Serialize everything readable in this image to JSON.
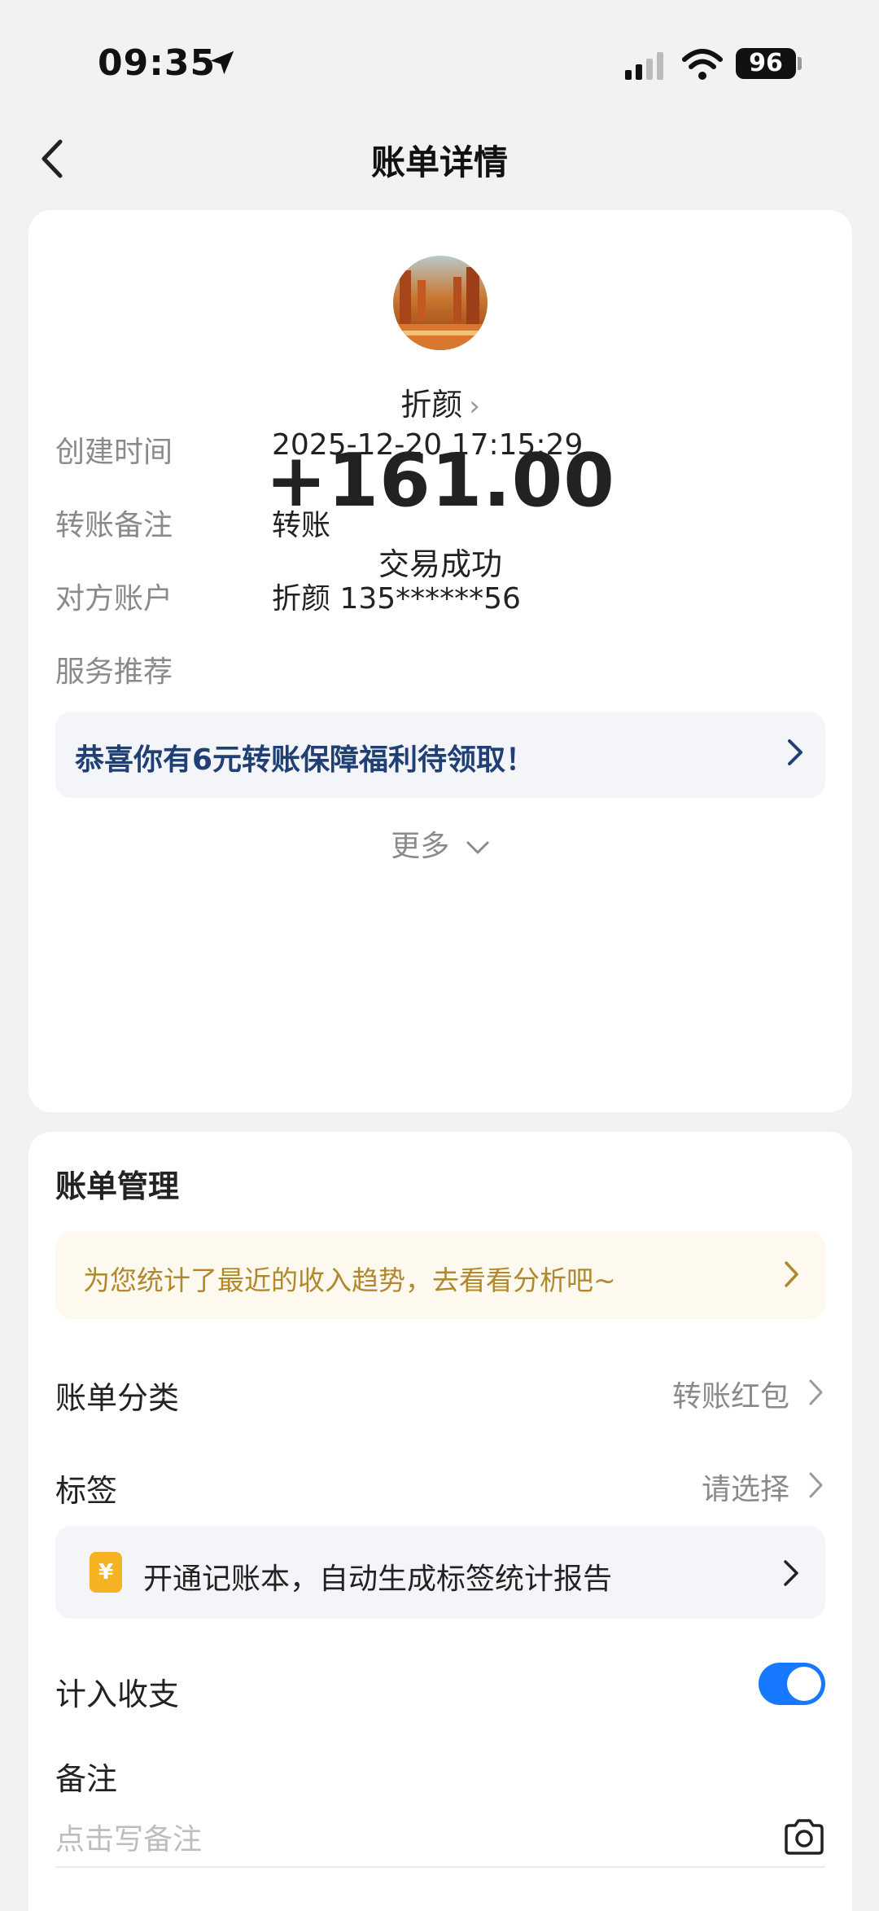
{
  "status_bar": {
    "time": "09:35",
    "battery": "96"
  },
  "nav": {
    "title": "账单详情"
  },
  "transaction": {
    "payee": "折颜",
    "amount": "+161.00",
    "status": "交易成功",
    "details": [
      {
        "label": "创建时间",
        "value": "2025-12-20 17:15:29"
      },
      {
        "label": "转账备注",
        "value": "转账"
      },
      {
        "label": "对方账户",
        "value": "折颜 135******56"
      },
      {
        "label": "服务推荐",
        "value": ""
      }
    ],
    "promo_banner": "恭喜你有6元转账保障福利待领取！",
    "more_label": "更多"
  },
  "management": {
    "title": "账单管理",
    "analysis_banner": "为您统计了最近的收入趋势，去看看分析吧~",
    "category": {
      "label": "账单分类",
      "value": "转账红包"
    },
    "tag": {
      "label": "标签",
      "value": "请选择"
    },
    "ledger_banner": {
      "icon_text": "¥",
      "text": "开通记账本，自动生成标签统计报告"
    },
    "include_stats": {
      "label": "计入收支",
      "enabled": true
    },
    "note": {
      "label": "备注",
      "placeholder": "点击写备注"
    }
  },
  "colors": {
    "accent": "#1677ff",
    "link_text": "#1f3f75",
    "tip_text": "#b0892f",
    "yen_badge": "#f5b324"
  },
  "icons": [
    "location-arrow-icon",
    "signal-icon",
    "wifi-icon",
    "back-chevron-icon",
    "chevron-right-icon",
    "chevron-down-icon",
    "yen-badge-icon",
    "camera-icon"
  ]
}
